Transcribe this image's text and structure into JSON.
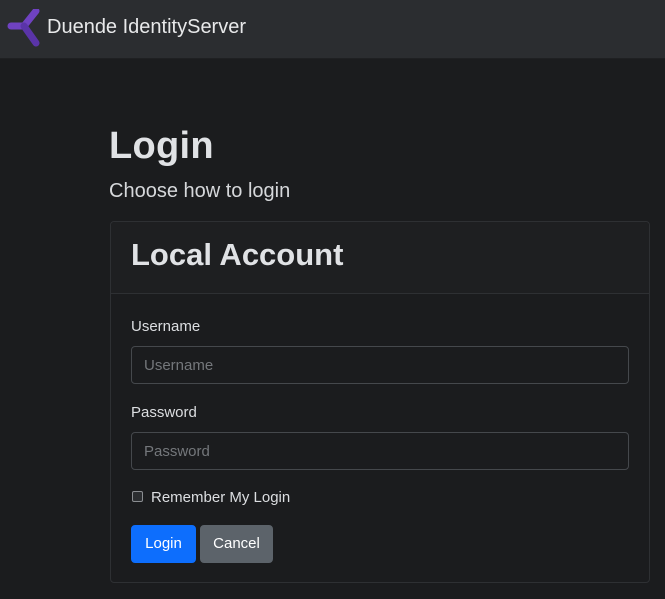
{
  "navbar": {
    "brand_name": "Duende IdentityServer",
    "logo_icon": "duende-logo-icon",
    "logo_color": "#6f42c1"
  },
  "page": {
    "title": "Login",
    "subtitle": "Choose how to login"
  },
  "local_account": {
    "title": "Local Account",
    "username": {
      "label": "Username",
      "placeholder": "Username",
      "value": ""
    },
    "password": {
      "label": "Password",
      "placeholder": "Password",
      "value": ""
    },
    "remember": {
      "label": "Remember My Login",
      "checked": false
    },
    "buttons": {
      "login_label": "Login",
      "cancel_label": "Cancel"
    }
  },
  "colors": {
    "primary": "#0d6efd",
    "secondary": "#5c636a",
    "background": "#1b1c1e",
    "navbar": "#2b2d30"
  }
}
